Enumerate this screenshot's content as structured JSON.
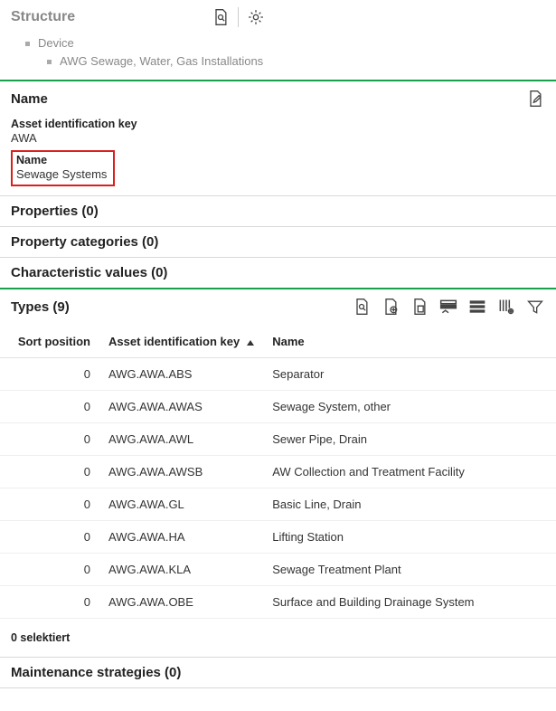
{
  "structure": {
    "title": "Structure",
    "tree": {
      "root": "Device",
      "child": "AWG Sewage, Water, Gas Installations"
    }
  },
  "nameSection": {
    "heading": "Name",
    "assetKeyLabel": "Asset identification key",
    "assetKeyValue": "AWA",
    "nameLabel": "Name",
    "nameValue": "Sewage Systems"
  },
  "propertiesSection": {
    "heading": "Properties (0)"
  },
  "propCategoriesSection": {
    "heading": "Property categories (0)"
  },
  "charValuesSection": {
    "heading": "Characteristic values (0)"
  },
  "typesSection": {
    "heading": "Types (9)",
    "columns": {
      "sort": "Sort position",
      "key": "Asset identification key",
      "name": "Name"
    },
    "rows": [
      {
        "sort": "0",
        "key": "AWG.AWA.ABS",
        "name": "Separator"
      },
      {
        "sort": "0",
        "key": "AWG.AWA.AWAS",
        "name": "Sewage System, other"
      },
      {
        "sort": "0",
        "key": "AWG.AWA.AWL",
        "name": "Sewer Pipe, Drain"
      },
      {
        "sort": "0",
        "key": "AWG.AWA.AWSB",
        "name": "AW Collection and Treatment Facility"
      },
      {
        "sort": "0",
        "key": "AWG.AWA.GL",
        "name": "Basic Line, Drain"
      },
      {
        "sort": "0",
        "key": "AWG.AWA.HA",
        "name": "Lifting Station"
      },
      {
        "sort": "0",
        "key": "AWG.AWA.KLA",
        "name": "Sewage Treatment Plant"
      },
      {
        "sort": "0",
        "key": "AWG.AWA.OBE",
        "name": "Surface and Building Drainage System"
      }
    ],
    "status": "0 selektiert"
  },
  "maintenanceSection": {
    "heading": "Maintenance strategies (0)"
  }
}
